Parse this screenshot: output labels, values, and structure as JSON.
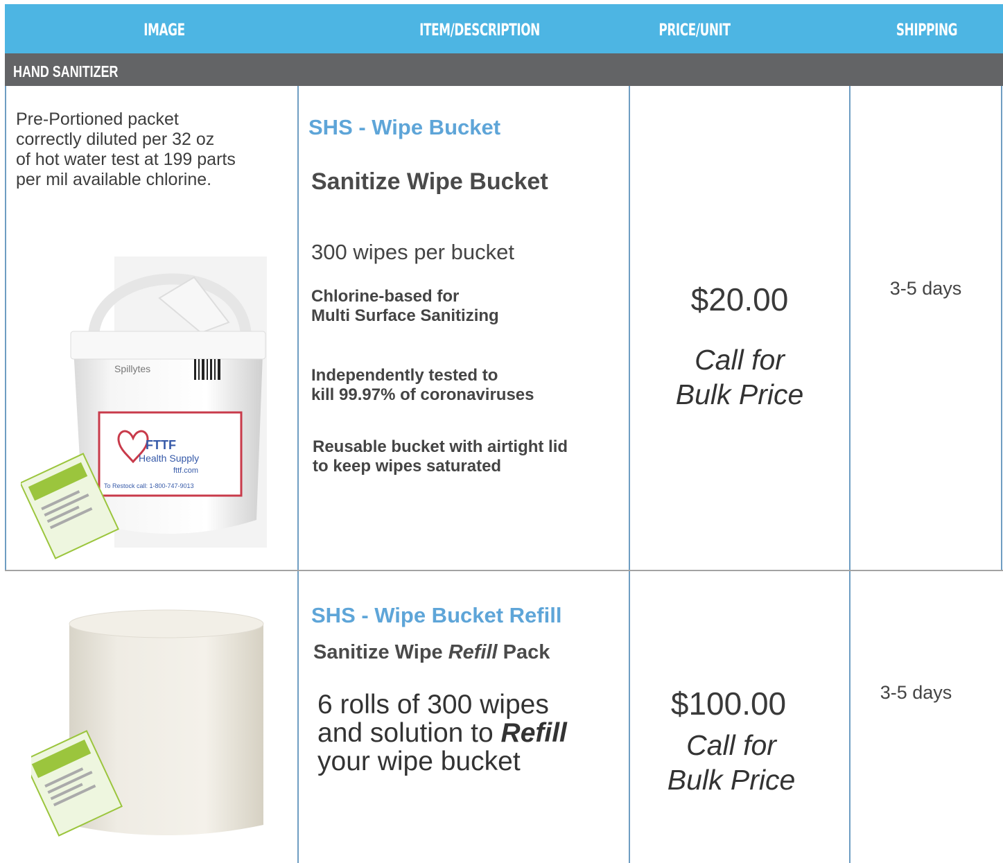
{
  "header": {
    "image": "IMAGE",
    "item": "ITEM/DESCRIPTION",
    "price": "PRICE/UNIT",
    "shipping": "SHIPPING"
  },
  "section": "HAND SANITIZER",
  "rows": [
    {
      "image_description": [
        "Pre-Portioned packet",
        "correctly diluted per 32 oz",
        "of hot  water test at  199 parts",
        "per mil  available chlorine."
      ],
      "code": "SHS - Wipe Bucket",
      "name": "Sanitize Wipe Bucket",
      "quantity": "300 wipes per bucket",
      "features": [
        [
          "Chlorine-based for",
          "Multi Surface Sanitizing"
        ],
        [
          "Independently tested to",
          "kill 99.97% of coronaviruses"
        ],
        [
          "Reusable bucket with airtight lid",
          "to keep wipes saturated"
        ]
      ],
      "price": "$20.00",
      "call": [
        "Call for",
        "Bulk Price"
      ],
      "shipping": "3-5 days",
      "label_text": [
        "FTTF",
        "Health Supply",
        "fttf.com",
        "To Restock call: 1-800-747-9013"
      ]
    },
    {
      "code": "SHS - Wipe Bucket Refill",
      "name_pre": "Sanitize Wipe ",
      "name_em": "Refill",
      "name_post": " Pack",
      "desc_lines": [
        "6 rolls of 300 wipes",
        "and solution to ",
        "Refill",
        "your wipe bucket"
      ],
      "price": "$100.00",
      "call": [
        "Call for",
        "Bulk Price"
      ],
      "shipping": "3-5 days"
    }
  ]
}
